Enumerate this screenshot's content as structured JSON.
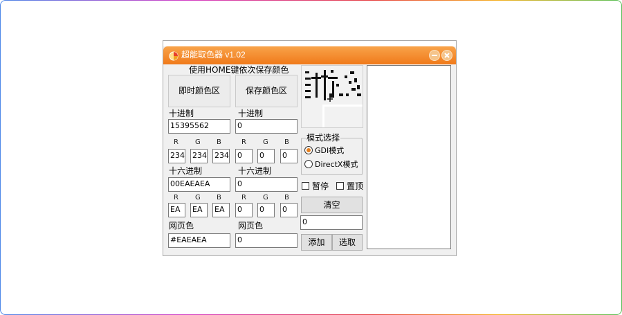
{
  "window": {
    "title": "超能取色器 v1.02"
  },
  "hint": "使用HOME键依次保存颜色",
  "left": {
    "area_button": "即时颜色区",
    "decimal_label": "十进制",
    "decimal_value": "15395562",
    "rgb_dec": {
      "r_label": "R",
      "g_label": "G",
      "b_label": "B",
      "r": "234",
      "g": "234",
      "b": "234"
    },
    "hex_label": "十六进制",
    "hex_value": "00EAEAEA",
    "rgb_hex": {
      "r_label": "R",
      "g_label": "G",
      "b_label": "B",
      "r": "EA",
      "g": "EA",
      "b": "EA"
    },
    "web_label": "网页色",
    "web_value": "#EAEAEA"
  },
  "right": {
    "area_button": "保存颜色区",
    "decimal_label": "十进制",
    "decimal_value": "0",
    "rgb_dec": {
      "r_label": "R",
      "g_label": "G",
      "b_label": "B",
      "r": "0",
      "g": "0",
      "b": "0"
    },
    "hex_label": "十六进制",
    "hex_value": "0",
    "rgb_hex": {
      "r_label": "R",
      "g_label": "G",
      "b_label": "B",
      "r": "0",
      "g": "0",
      "b": "0"
    },
    "web_label": "网页色",
    "web_value": "0"
  },
  "mode": {
    "label": "模式选择",
    "options": [
      "GDI模式",
      "DirectX模式"
    ],
    "selected": "GDI模式"
  },
  "pause_label": "暂停",
  "top_label": "置顶",
  "clear_button": "清空",
  "count_value": "0",
  "add_button": "添加",
  "pick_button": "选取",
  "colors": {
    "titlebar": "#f07a1a",
    "accent": "#e57e1c",
    "window_bg": "#f0f0f0"
  }
}
